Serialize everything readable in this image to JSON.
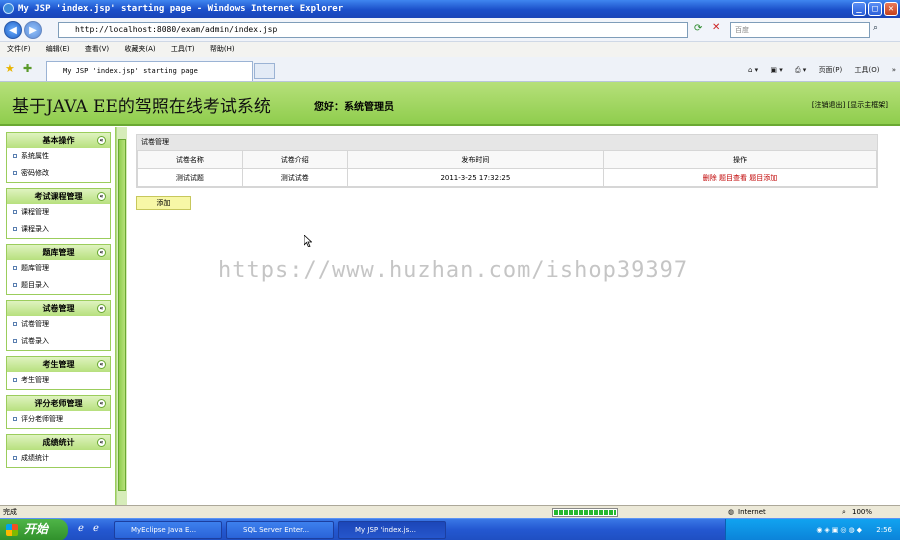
{
  "window": {
    "title": "My JSP 'index.jsp' starting page - Windows Internet Explorer",
    "minimize_glyph": "_",
    "maximize_glyph": "□",
    "close_glyph": "✕"
  },
  "address_bar": {
    "url": "http://localhost:8080/exam/admin/index.jsp",
    "search_placeholder": "百度"
  },
  "menu": [
    "文件(F)",
    "编辑(E)",
    "查看(V)",
    "收藏夹(A)",
    "工具(T)",
    "帮助(H)"
  ],
  "tab": {
    "label": "My JSP 'index.jsp' starting page"
  },
  "command_bar": {
    "page_label": "页面(P)",
    "tools_label": "工具(O)"
  },
  "header": {
    "title": "基于JAVA EE的驾照在线考试系统",
    "greeting": "您好：系统管理员",
    "logout_link": "[注销退出]",
    "show_frame_link": "[显示主框架]"
  },
  "sidebar": {
    "groups": [
      {
        "title": "基本操作",
        "items": [
          "系统属性",
          "密码修改"
        ]
      },
      {
        "title": "考试课程管理",
        "items": [
          "课程管理",
          "课程录入"
        ]
      },
      {
        "title": "题库管理",
        "items": [
          "题库管理",
          "题目录入"
        ]
      },
      {
        "title": "试卷管理",
        "items": [
          "试卷管理",
          "试卷录入"
        ]
      },
      {
        "title": "考生管理",
        "items": [
          "考生管理"
        ]
      },
      {
        "title": "评分老师管理",
        "items": [
          "评分老师管理"
        ]
      },
      {
        "title": "成绩统计",
        "items": [
          "成绩统计"
        ]
      }
    ]
  },
  "main": {
    "panel_title": "试卷管理",
    "columns": [
      "试卷名称",
      "试卷介绍",
      "发布时间",
      "操作"
    ],
    "rows": [
      {
        "name": "测试试题",
        "intro": "测试试卷",
        "time": "2011-3-25 17:32:25",
        "actions": [
          "删除",
          "题目查看",
          "题目添加"
        ]
      }
    ],
    "add_button": "添加"
  },
  "watermark": "https://www.huzhan.com/ishop39397",
  "status": {
    "text": "完成",
    "zone": "Internet",
    "zoom": "100%",
    "progress": 1.0
  },
  "taskbar": {
    "start_label": "开始",
    "tasks": [
      "MyEclipse Java E...",
      "SQL Server Enter...",
      "My JSP 'index.js..."
    ],
    "clock": "2:56"
  },
  "colors": {
    "header_green": "#8fcd4d",
    "action_red": "#c00000",
    "add_button_yellow": "#f7f7a6"
  }
}
